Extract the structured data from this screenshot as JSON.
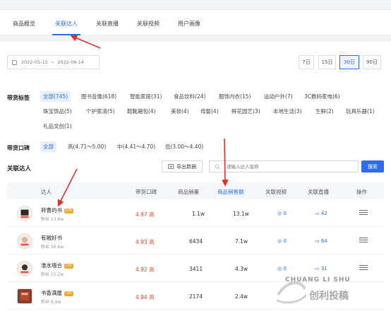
{
  "tabs": [
    {
      "label": "商品概览"
    },
    {
      "label": "关联达人"
    },
    {
      "label": "关联直播"
    },
    {
      "label": "关联视频"
    },
    {
      "label": "用户画像"
    }
  ],
  "date": {
    "start": "2022-05-15",
    "end": "2022-06-14",
    "sep": "~"
  },
  "periods": [
    "7日",
    "15日",
    "30日",
    "90日"
  ],
  "tags": {
    "label": "带货标签",
    "items": [
      "全部(745)",
      "图书音像(618)",
      "智能家居(31)",
      "食品饮料(24)",
      "服饰内衣(15)",
      "运动户外(7)",
      "3C数码家电(6)",
      "珠宝饰品(5)",
      "个护家清(5)",
      "鞋靴箱包(4)",
      "美妆(4)",
      "母婴(4)",
      "鲜花园艺(3)",
      "本地生活(3)",
      "生鲜(2)",
      "玩具乐器(1)",
      "礼品文创(1)"
    ]
  },
  "reputation": {
    "label": "带货口碑",
    "items": [
      "全部",
      "高(4.71～5.00)",
      "中(4.41～4.70)",
      "低(3.00～4.40)"
    ]
  },
  "section": {
    "title": "关联达人",
    "export": "导出数据",
    "search_placeholder": "请输入达人名称",
    "search_btn": "搜索"
  },
  "table": {
    "headers": [
      "达人",
      "带货口碑",
      "商品销量",
      "商品销售额",
      "关联视频",
      "关联直播",
      "操作"
    ],
    "rows": [
      {
        "name": "转曹的书",
        "fans": "粉丝 13.8w",
        "lv": "LV5",
        "score": "4.97 高",
        "sales": "1.1w",
        "amount": "13.1w",
        "videos": "0",
        "lives": "42"
      },
      {
        "name": "有贼好书",
        "fans": "粉丝 16.6w",
        "lv": "",
        "score": "4.93 高",
        "sales": "6434",
        "amount": "7.1w",
        "videos": "0",
        "lives": "64"
      },
      {
        "name": "淮水墙合",
        "fans": "粉丝 15.2w",
        "lv": "LV5",
        "score": "4.92 高",
        "sales": "3411",
        "amount": "4.3w",
        "videos": "0",
        "lives": "31"
      },
      {
        "name": "书香满屋",
        "fans": "粉丝 6.9w",
        "lv": "LV5",
        "score": "4.94 高",
        "sales": "2174",
        "amount": "2.4w",
        "videos": "",
        "lives": ""
      }
    ]
  },
  "watermark": {
    "line1": "CHUANG LI SHU",
    "line2": "创利投稿"
  },
  "colors": {
    "accent": "#2f6bf0",
    "score": "#e0402a",
    "arrow": "#e0302a",
    "level": "#f3a531"
  }
}
